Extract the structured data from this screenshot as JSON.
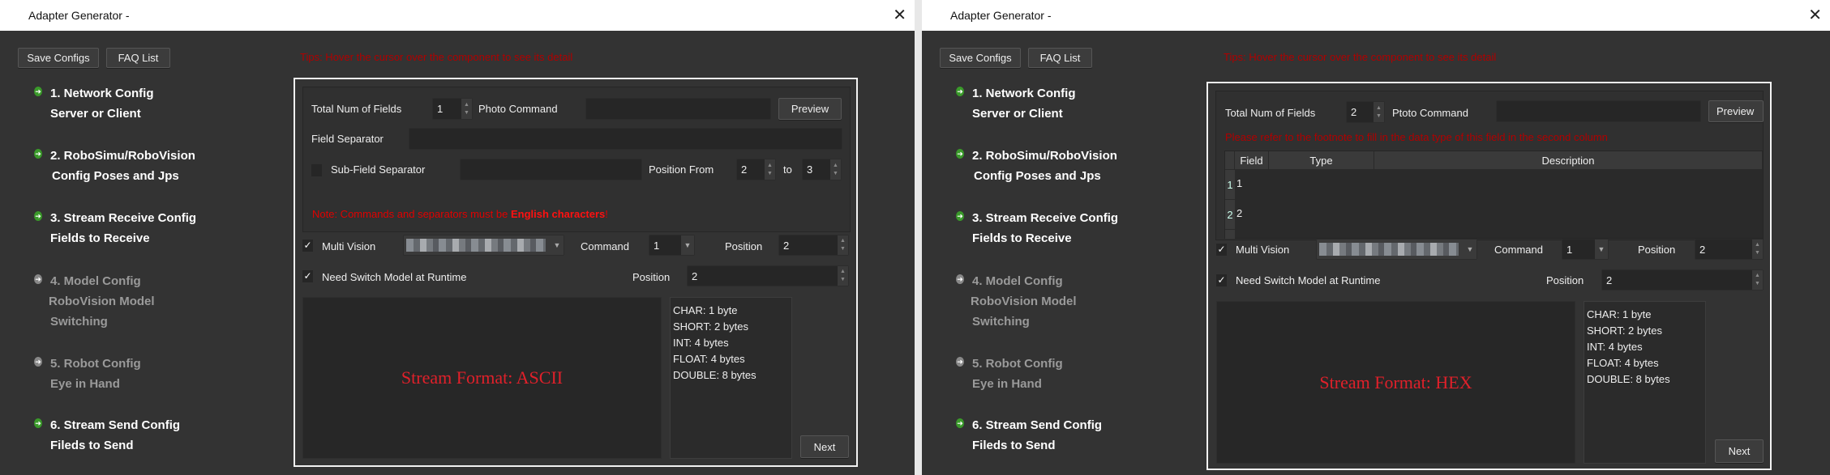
{
  "windows": [
    {
      "title": "Adapter Generator -",
      "toolbar": {
        "save_label": "Save Configs",
        "faq_label": "FAQ List"
      },
      "tips": "Tips: Hover the cursor over the component to see its detail",
      "sidebar": [
        {
          "line1": "1. Network Config",
          "line2": "Server or Client",
          "enabled": true
        },
        {
          "line1": "2. RoboSimu/RoboVision",
          "line2": "Config Poses and Jps",
          "enabled": true
        },
        {
          "line1": "3. Stream Receive Config",
          "line2": "Fields to Receive",
          "enabled": true
        },
        {
          "line1": "4. Model Config",
          "line2": "RoboVision Model",
          "line3": "Switching",
          "enabled": false
        },
        {
          "line1": "5. Robot Config",
          "line2": "Eye in Hand",
          "enabled": false
        },
        {
          "line1": "6. Stream Send Config",
          "line2": "Fileds to Send",
          "enabled": true
        }
      ],
      "form": {
        "total_fields_label": "Total Num of Fields",
        "total_fields_value": "1",
        "photo_command_label": "Photo Command",
        "photo_command_value": "",
        "preview_label": "Preview",
        "field_separator_label": "Field Separator",
        "field_separator_value": "",
        "sub_field_label": "Sub-Field Separator",
        "sub_field_checked": false,
        "sub_field_value": "",
        "position_from_label": "Position From",
        "position_from_value": "2",
        "to_label": "to",
        "position_to_value": "3",
        "note_prefix": "Note: Commands and separators must be ",
        "note_bold": "English characters",
        "note_suffix": "!",
        "multi_vision_label": "Multi Vision",
        "multi_vision_checked": true,
        "command_label": "Command",
        "command_value": "1",
        "position_label": "Position",
        "position_value": "2",
        "switch_model_label": "Need Switch Model at Runtime",
        "switch_model_checked": true,
        "switch_position_label": "Position",
        "switch_position_value": "2"
      },
      "stream_format": "Stream Format: ASCII",
      "sizes": [
        "CHAR: 1 byte",
        "SHORT: 2 bytes",
        "INT: 4 bytes",
        "FLOAT: 4 bytes",
        "DOUBLE: 8 bytes"
      ],
      "next_label": "Next"
    },
    {
      "title": "Adapter Generator -",
      "toolbar": {
        "save_label": "Save Configs",
        "faq_label": "FAQ List"
      },
      "tips": "Tips: Hover the cursor over the component to see its detail",
      "sidebar": [
        {
          "line1": "1. Network Config",
          "line2": "Server or Client",
          "enabled": true
        },
        {
          "line1": "2. RoboSimu/RoboVision",
          "line2": "Config Poses and Jps",
          "enabled": true
        },
        {
          "line1": "3. Stream Receive Config",
          "line2": "Fields to Receive",
          "enabled": true
        },
        {
          "line1": "4. Model Config",
          "line2": "RoboVision Model",
          "line3": "Switching",
          "enabled": false
        },
        {
          "line1": "5. Robot Config",
          "line2": "Eye in Hand",
          "enabled": false
        },
        {
          "line1": "6. Stream Send Config",
          "line2": "Fileds to Send",
          "enabled": true
        }
      ],
      "form": {
        "total_fields_label": "Total Num of Fields",
        "total_fields_value": "2",
        "photo_command_label": "Ptoto Command",
        "photo_command_value": "",
        "preview_label": "Preview",
        "hint": "Please refer to the footnote to fill in the data type of this field in the second column",
        "table": {
          "headers": [
            "Field",
            "Type",
            "Description"
          ],
          "rows": [
            {
              "index": "1",
              "field": "1",
              "type": "",
              "description": ""
            },
            {
              "index": "2",
              "field": "2",
              "type": "",
              "description": ""
            }
          ]
        },
        "multi_vision_label": "Multi Vision",
        "multi_vision_checked": true,
        "command_label": "Command",
        "command_value": "1",
        "position_label": "Position",
        "position_value": "2",
        "switch_model_label": "Need Switch Model at Runtime",
        "switch_model_checked": true,
        "switch_position_label": "Position",
        "switch_position_value": "2"
      },
      "stream_format": "Stream Format: HEX",
      "sizes": [
        "CHAR: 1 byte",
        "SHORT: 2 bytes",
        "INT: 4 bytes",
        "FLOAT: 4 bytes",
        "DOUBLE: 8 bytes"
      ],
      "next_label": "Next"
    }
  ]
}
